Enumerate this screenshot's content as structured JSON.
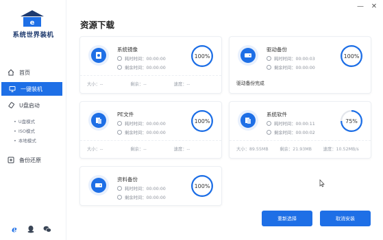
{
  "brand": {
    "name": "系统世界装机"
  },
  "window": {
    "minimize": "—",
    "close": "✕"
  },
  "sidebar": {
    "items": [
      {
        "label": "首页",
        "icon": "home-icon"
      },
      {
        "label": "一键装机",
        "icon": "monitor-icon"
      },
      {
        "label": "U盘启动",
        "icon": "usb-icon"
      },
      {
        "label": "备份还原",
        "icon": "backup-icon"
      }
    ],
    "sub_items": [
      "U盘模式",
      "ISO模式",
      "本地模式"
    ],
    "bottom_icons": [
      "ie-icon",
      "qq-icon",
      "wechat-icon"
    ]
  },
  "main": {
    "title": "资源下载",
    "cards": [
      {
        "name": "系统镜像",
        "elapsed": "耗时时间：00:00:00",
        "remaining": "剩余时间：00:00:00",
        "percent": "100%",
        "size": "大小：--",
        "left": "剩余：--",
        "speed": "速度：--",
        "status": ""
      },
      {
        "name": "驱动备份",
        "elapsed": "耗时时间：00:00:03",
        "remaining": "剩余时间：00:00:00",
        "percent": "100%",
        "size": "",
        "left": "",
        "speed": "",
        "status": "驱动备份完成"
      },
      {
        "name": "PE文件",
        "elapsed": "耗时时间：00:00:00",
        "remaining": "剩余时间：00:00:00",
        "percent": "100%",
        "size": "大小：--",
        "left": "剩余：--",
        "speed": "速度：--",
        "status": ""
      },
      {
        "name": "系统软件",
        "elapsed": "耗时时间：00:00:11",
        "remaining": "剩余时间：00:00:02",
        "percent": "75%",
        "size": "大小：89.55MB",
        "left": "剩余：21.93MB",
        "speed": "速度：10.52MB/s",
        "status": ""
      },
      {
        "name": "资料备份",
        "elapsed": "耗时时间：00:00:00",
        "remaining": "剩余时间：00:00:00",
        "percent": "100%",
        "size": "",
        "left": "",
        "speed": "",
        "status": ""
      }
    ],
    "progress": [
      1.0,
      1.0,
      1.0,
      0.75,
      1.0
    ]
  },
  "buttons": {
    "reselect": "重新选择",
    "cancel_install": "取消安装"
  },
  "colors": {
    "accent": "#1e6fe6",
    "ring_track": "#e3e6ec",
    "brand_text": "#1e3a6e"
  }
}
